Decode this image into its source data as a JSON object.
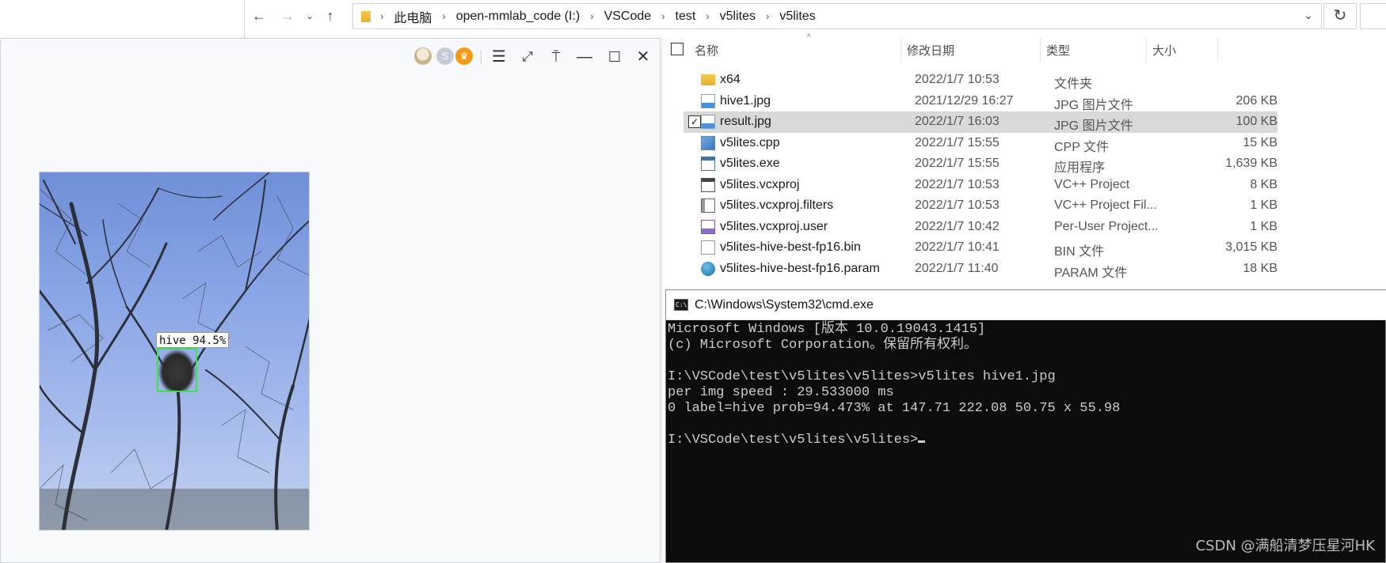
{
  "explorer": {
    "breadcrumbs": [
      "此电脑",
      "open-mmlab_code (I:)",
      "VSCode",
      "test",
      "v5lites",
      "v5lites"
    ],
    "columns": {
      "name": "名称",
      "modified": "修改日期",
      "type": "类型",
      "size": "大小"
    },
    "files": [
      {
        "name": "x64",
        "modified": "2022/1/7 10:53",
        "type": "文件夹",
        "size": "",
        "icon": "folder-icon",
        "selected": false
      },
      {
        "name": "hive1.jpg",
        "modified": "2021/12/29 16:27",
        "type": "JPG 图片文件",
        "size": "206 KB",
        "icon": "image-file-icon",
        "selected": false
      },
      {
        "name": "result.jpg",
        "modified": "2022/1/7 16:03",
        "type": "JPG 图片文件",
        "size": "100 KB",
        "icon": "image-file-icon",
        "selected": true
      },
      {
        "name": "v5lites.cpp",
        "modified": "2022/1/7 15:55",
        "type": "CPP 文件",
        "size": "15 KB",
        "icon": "cpp-file-icon",
        "selected": false
      },
      {
        "name": "v5lites.exe",
        "modified": "2022/1/7 15:55",
        "type": "应用程序",
        "size": "1,639 KB",
        "icon": "exe-file-icon",
        "selected": false
      },
      {
        "name": "v5lites.vcxproj",
        "modified": "2022/1/7 10:53",
        "type": "VC++ Project",
        "size": "8 KB",
        "icon": "vcxproj-file-icon",
        "selected": false
      },
      {
        "name": "v5lites.vcxproj.filters",
        "modified": "2022/1/7 10:53",
        "type": "VC++ Project Fil...",
        "size": "1 KB",
        "icon": "filters-file-icon",
        "selected": false
      },
      {
        "name": "v5lites.vcxproj.user",
        "modified": "2022/1/7 10:42",
        "type": "Per-User Project...",
        "size": "1 KB",
        "icon": "user-file-icon",
        "selected": false
      },
      {
        "name": "v5lites-hive-best-fp16.bin",
        "modified": "2022/1/7 10:41",
        "type": "BIN 文件",
        "size": "3,015 KB",
        "icon": "bin-file-icon",
        "selected": false
      },
      {
        "name": "v5lites-hive-best-fp16.param",
        "modified": "2022/1/7 11:40",
        "type": "PARAM 文件",
        "size": "18 KB",
        "icon": "param-file-icon",
        "selected": false
      }
    ]
  },
  "viewer": {
    "detection_label": "hive 94.5%"
  },
  "cmd": {
    "title": "C:\\Windows\\System32\\cmd.exe",
    "icon_text": "C:\\",
    "lines": [
      "Microsoft Windows [版本 10.0.19043.1415]",
      "(c) Microsoft Corporation。保留所有权利。",
      "",
      "I:\\VSCode\\test\\v5lites\\v5lites>v5lites hive1.jpg",
      "per img speed : 29.533000 ms",
      "0 label=hive prob=94.473% at 147.71 222.08 50.75 x 55.98",
      "",
      "I:\\VSCode\\test\\v5lites\\v5lites>"
    ]
  },
  "watermark": "CSDN @满船清梦压星河HK",
  "colors": {
    "cmd_bg": "#0c0c0c",
    "cmd_text": "#cccccc",
    "selection": "#d9d9d9",
    "detection_box": "#3fe04a",
    "viewer_bg": "#f7f9fd"
  }
}
